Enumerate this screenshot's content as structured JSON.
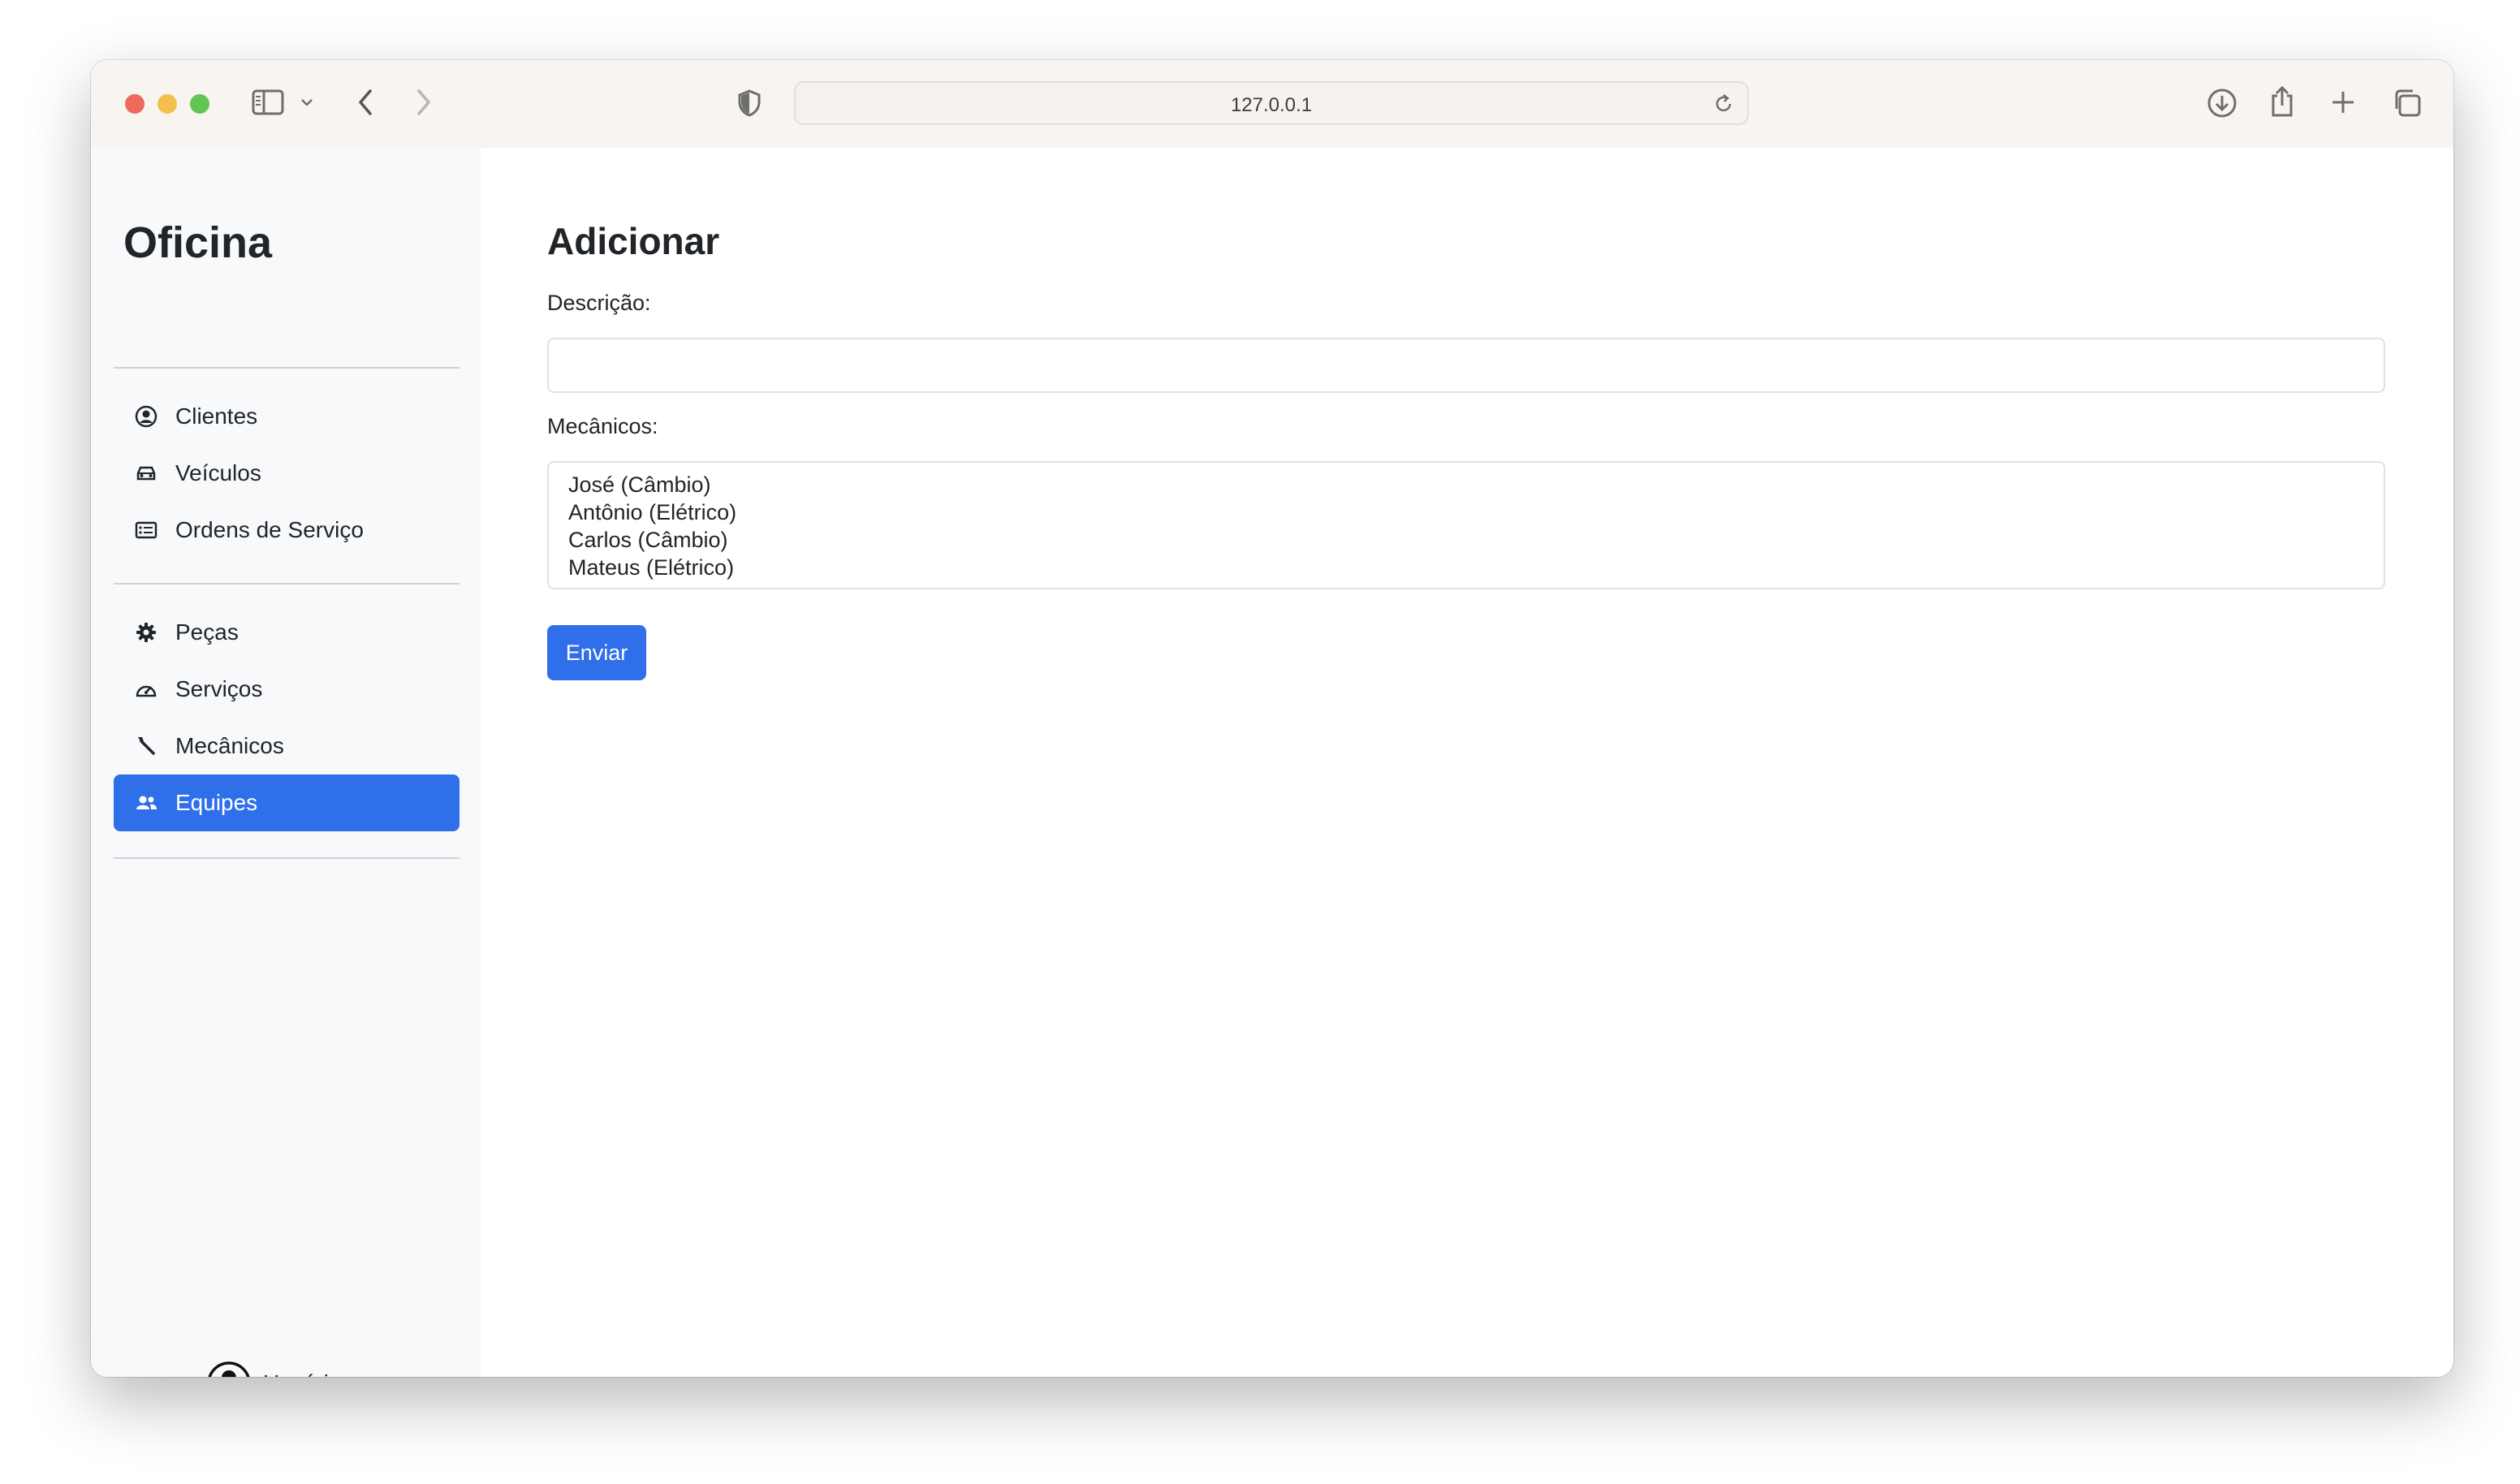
{
  "browser": {
    "url": "127.0.0.1"
  },
  "sidebar": {
    "brand": "Oficina",
    "group1": [
      {
        "label": "Clientes",
        "icon": "person-circle-icon"
      },
      {
        "label": "Veículos",
        "icon": "car-icon"
      },
      {
        "label": "Ordens de Serviço",
        "icon": "card-list-icon"
      }
    ],
    "group2": [
      {
        "label": "Peças",
        "icon": "gear-icon"
      },
      {
        "label": "Serviços",
        "icon": "speedometer-icon"
      },
      {
        "label": "Mecânicos",
        "icon": "wrench-icon"
      },
      {
        "label": "Equipes",
        "icon": "people-icon",
        "active": true
      }
    ],
    "user": "Usuário"
  },
  "main": {
    "title": "Adicionar",
    "descricao_label": "Descrição:",
    "descricao_value": "",
    "mecanicos_label": "Mecânicos:",
    "mecanicos_options": [
      "José (Câmbio)",
      "Antônio (Elétrico)",
      "Carlos (Câmbio)",
      "Mateus (Elétrico)"
    ],
    "submit_label": "Enviar"
  },
  "colors": {
    "accent": "#2f6fea",
    "sidebar_bg": "#f8f9fa"
  }
}
